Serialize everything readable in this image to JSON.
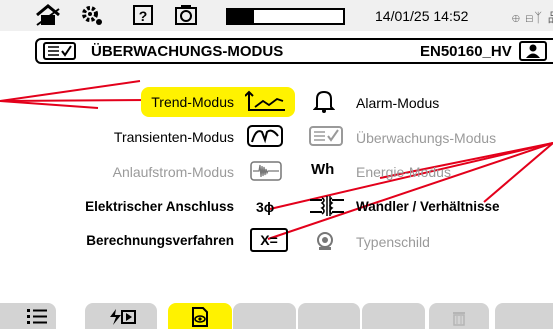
{
  "status": {
    "icons": [
      "home-icon",
      "settings-icon",
      "help-icon",
      "camera-icon"
    ],
    "battery_level": 0.23,
    "datetime": "14/01/25 14:52",
    "network_icons": "⊕ ⊟ᛉ 品 ▥"
  },
  "header": {
    "title": "ÜBERWACHUNGS-MODUS",
    "profile": "EN50160_HV"
  },
  "menu": {
    "trend": "Trend-Modus",
    "alarm": "Alarm-Modus",
    "transient": "Transienten-Modus",
    "monitoring": "Überwachungs-Modus",
    "inrush": "Anlaufstrom-Modus",
    "energy": "Energie-Modus",
    "energy_symbol": "Wh",
    "connection": "Elektrischer Anschluss",
    "connection_symbol": "3ϕ",
    "ratio": "Wandler / Verhältnisse",
    "calc": "Berechnungsverfahren",
    "calc_symbol": "X=",
    "nameplate": "Typenschild"
  },
  "colors": {
    "accent": "#fff200",
    "callout": "#e3001b",
    "disabled": "#9a9a9a",
    "tab": "#d3d3d3"
  }
}
